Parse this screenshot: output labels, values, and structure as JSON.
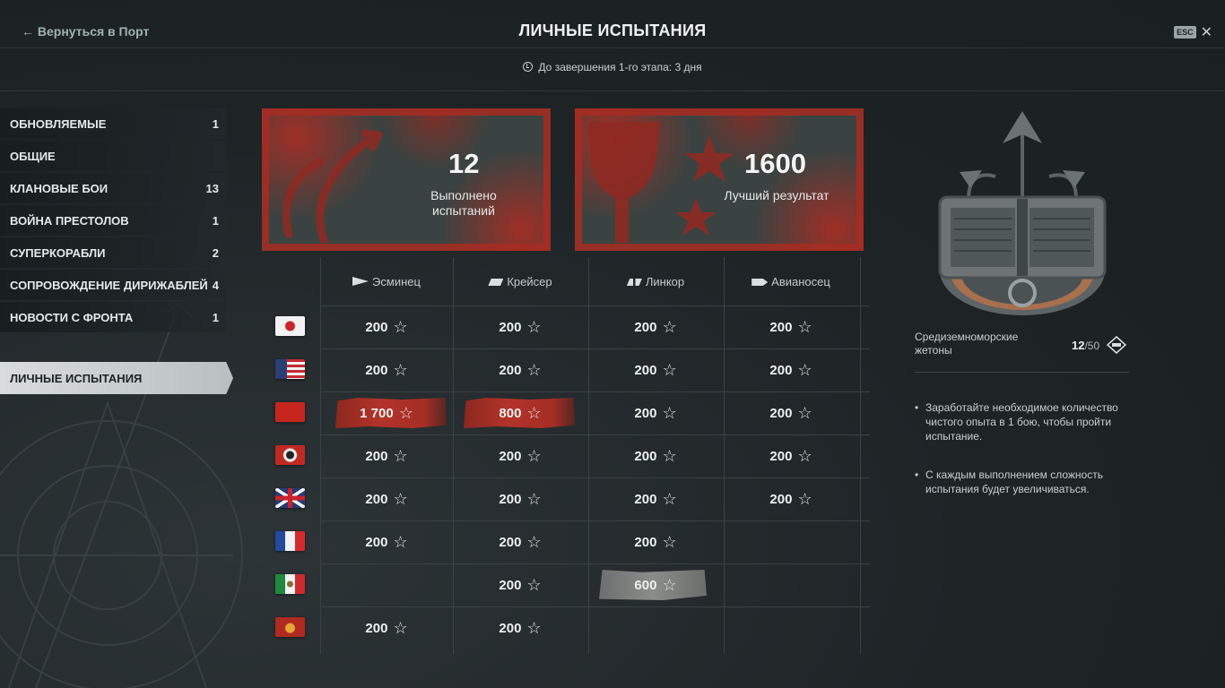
{
  "header": {
    "back_label": "Вернуться в Порт",
    "title": "ЛИЧНЫЕ ИСПЫТАНИЯ",
    "esc_label": "ESC",
    "close_glyph": "✕",
    "timer": "До завершения 1-го этапа: 3 дня"
  },
  "sidebar": {
    "items": [
      {
        "label": "ОБНОВЛЯЕМЫЕ",
        "count": "1"
      },
      {
        "label": "ОБЩИЕ",
        "count": ""
      },
      {
        "label": "КЛАНОВЫЕ БОИ",
        "count": "13"
      },
      {
        "label": "ВОЙНА ПРЕСТОЛОВ",
        "count": "1"
      },
      {
        "label": "СУПЕРКОРАБЛИ",
        "count": "2"
      },
      {
        "label": "СОПРОВОЖДЕНИЕ ДИРИЖАБЛЕЙ",
        "count": "4"
      },
      {
        "label": "НОВОСТИ С ФРОНТА",
        "count": "1"
      }
    ],
    "active": "ЛИЧНЫЕ ИСПЫТАНИЯ"
  },
  "stats": {
    "completed_value": "12",
    "completed_label_1": "Выполнено",
    "completed_label_2": "испытаний",
    "best_value": "1600",
    "best_label": "Лучший результат"
  },
  "table": {
    "columns": [
      "Эсминец",
      "Крейсер",
      "Линкор",
      "Авианосец"
    ],
    "column_icons": [
      "destroyer-class-icon",
      "cruiser-class-icon",
      "battleship-class-icon",
      "carrier-class-icon"
    ],
    "star_glyph": "☆",
    "rows": [
      {
        "nation": "japan",
        "cells": [
          "200",
          "200",
          "200",
          "200"
        ]
      },
      {
        "nation": "usa",
        "cells": [
          "200",
          "200",
          "200",
          "200"
        ]
      },
      {
        "nation": "ussr",
        "cells": [
          "1 700",
          "800",
          "200",
          "200"
        ],
        "highlight": [
          "red",
          "red",
          "",
          ""
        ]
      },
      {
        "nation": "germany",
        "cells": [
          "200",
          "200",
          "200",
          "200"
        ]
      },
      {
        "nation": "uk",
        "cells": [
          "200",
          "200",
          "200",
          "200"
        ]
      },
      {
        "nation": "france",
        "cells": [
          "200",
          "200",
          "200",
          ""
        ]
      },
      {
        "nation": "italy",
        "cells": [
          "",
          "200",
          "600",
          ""
        ],
        "highlight": [
          "",
          "",
          "gray",
          ""
        ]
      },
      {
        "nation": "pan-europe",
        "cells": [
          "200",
          "200",
          "",
          ""
        ]
      }
    ]
  },
  "token": {
    "name_1": "Средиземноморские",
    "name_2": "жетоны",
    "current": "12",
    "max": "/50"
  },
  "info": [
    "Заработайте необходимое количество чистого опыта в 1 бою, чтобы пройти испытание.",
    "С каждым выполнением сложность испытания будет увеличиваться."
  ],
  "colors": {
    "accent_red": "#b23329",
    "active_tab": "#d9dcdc",
    "background": "#1f2527"
  }
}
